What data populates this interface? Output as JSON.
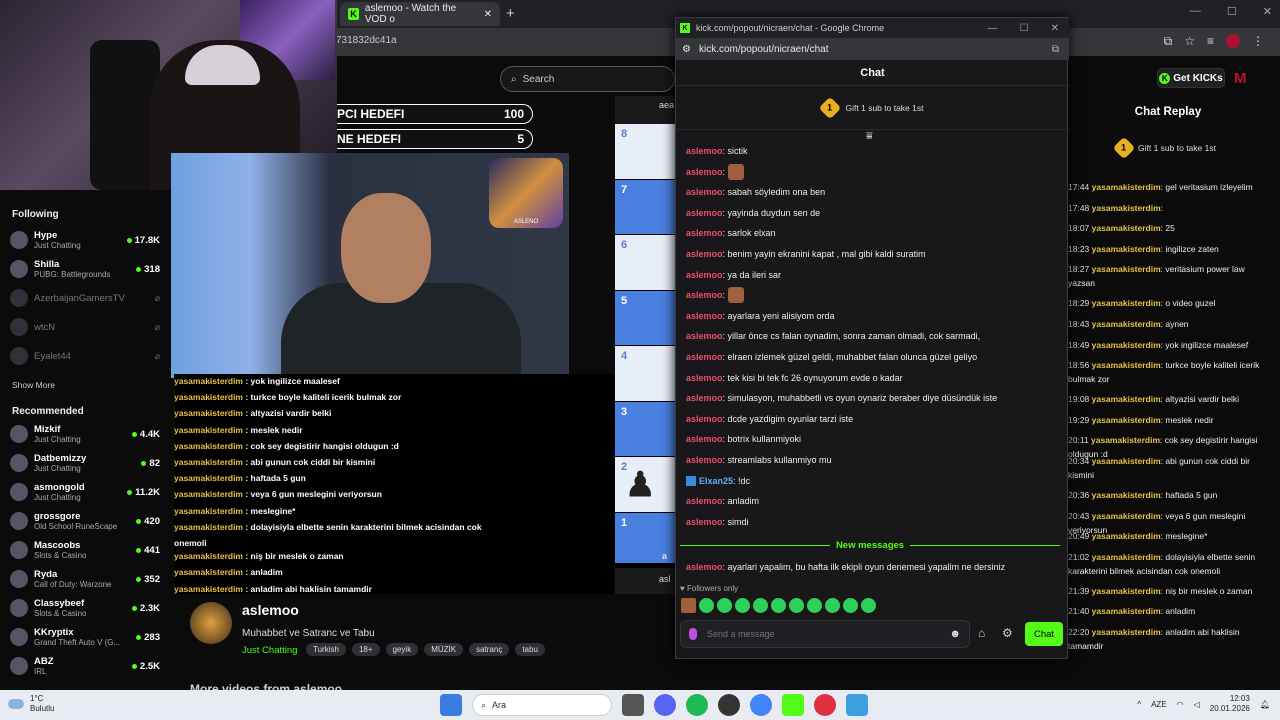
{
  "browser": {
    "tab_title": "aslemoo - Watch the VOD o",
    "url_fragment": "731832dc41a"
  },
  "kick": {
    "search_placeholder": "Search",
    "get_kicks": "Get KICKs",
    "following_heading": "Following",
    "show_more": "Show More",
    "recommended_heading": "Recommended",
    "following": [
      {
        "name": "Hype",
        "category": "Just Chatting",
        "viewers": "17.8K",
        "live": true
      },
      {
        "name": "Shilla",
        "category": "PUBG: Battlegrounds",
        "viewers": "318",
        "live": true
      },
      {
        "name": "AzerbaijanGamersTV",
        "category": "",
        "viewers": "",
        "live": false
      },
      {
        "name": "wtcN",
        "category": "",
        "viewers": "",
        "live": false
      },
      {
        "name": "Eyalet44",
        "category": "",
        "viewers": "",
        "live": false
      }
    ],
    "recommended": [
      {
        "name": "Mizkif",
        "category": "Just Chatting",
        "viewers": "4.4K"
      },
      {
        "name": "Datbemizzy",
        "category": "Just Chatting",
        "viewers": "82"
      },
      {
        "name": "asmongold",
        "category": "Just Chatting",
        "viewers": "11.2K"
      },
      {
        "name": "grossgore",
        "category": "Old School RuneScape",
        "viewers": "420"
      },
      {
        "name": "Mascoobs",
        "category": "Slots & Casino",
        "viewers": "441"
      },
      {
        "name": "Ryda",
        "category": "Call of Duty: Warzone",
        "viewers": "352"
      },
      {
        "name": "Classybeef",
        "category": "Slots & Casino",
        "viewers": "2.3K"
      },
      {
        "name": "KKryptix",
        "category": "Grand Theft Auto V (G...",
        "viewers": "283"
      },
      {
        "name": "ABZ",
        "category": "IRL",
        "viewers": "2.5K"
      }
    ]
  },
  "stream": {
    "goals": [
      {
        "label": "PCI HEDEFI",
        "value": "100"
      },
      {
        "label": "NE HEDEFI",
        "value": "5"
      }
    ],
    "cam_logo_text": "ASLENO",
    "overlay_chat": [
      {
        "user": "yasamakisterdim",
        "text": " : yok ingilizce maalesef"
      },
      {
        "user": "yasamakisterdim",
        "text": " : turkce boyle kaliteli icerik bulmak zor"
      },
      {
        "user": "yasamakisterdim",
        "text": " : altyazisi vardir belki"
      },
      {
        "user": "yasamakisterdim",
        "text": " : meslek nedir"
      },
      {
        "user": "yasamakisterdim",
        "text": " : cok sey degistirir hangisi oldugun :d"
      },
      {
        "user": "yasamakisterdim",
        "text": " : abi gunun cok ciddi bir kismini"
      },
      {
        "user": "yasamakisterdim",
        "text": " : haftada 5 gun"
      },
      {
        "user": "yasamakisterdim",
        "text": " : veya 6 gun meslegini veriyorsun"
      },
      {
        "user": "yasamakisterdim",
        "text": " : meslegine*"
      },
      {
        "user": "yasamakisterdim",
        "text": " : dolayisiyla elbette senin karakterini bilmek acisindan cok"
      },
      {
        "user": "",
        "text": "onemoli"
      },
      {
        "user": "yasamakisterdim",
        "text": " : niş bir meslek o zaman"
      },
      {
        "user": "yasamakisterdim",
        "text": " : anladim"
      },
      {
        "user": "yasamakisterdim",
        "text": " : anladim abi haklisin tamamdir"
      }
    ],
    "board_ranks": [
      "8",
      "7",
      "6",
      "5",
      "4",
      "3",
      "2",
      "1"
    ],
    "board_top_label": "aea",
    "board_bottom_label": "asl",
    "board_file_label": "a",
    "pawn": "♟"
  },
  "stream_info": {
    "channel": "aslemoo",
    "title": "Muhabbet ve Satranc ve Tabu",
    "category": "Just Chatting",
    "tags": [
      "Turkish",
      "18+",
      "geyik",
      "MÜZİK",
      "satranç",
      "tabu"
    ],
    "more_videos": "More videos from aslemoo"
  },
  "replay": {
    "title": "Chat Replay",
    "gift_text": "Gift 1 sub to take 1st",
    "messages": [
      {
        "time": "17:44",
        "user": "yasamakisterdim",
        "text": ": gel veritasium izleyelim"
      },
      {
        "time": "17:48",
        "user": "yasamakisterdim",
        "text": ":"
      },
      {
        "time": "18:07",
        "user": "yasamakisterdim",
        "text": ": 25"
      },
      {
        "time": "18:23",
        "user": "yasamakisterdim",
        "text": ": ingilizce zaten"
      },
      {
        "time": "18:27",
        "user": "yasamakisterdim",
        "text": ": veritasium power law yazsan"
      },
      {
        "time": "18:29",
        "user": "yasamakisterdim",
        "text": ": o video guzel"
      },
      {
        "time": "18:43",
        "user": "yasamakisterdim",
        "text": ": aynen"
      },
      {
        "time": "18:49",
        "user": "yasamakisterdim",
        "text": ": yok ingilizce maalesef"
      },
      {
        "time": "18:56",
        "user": "yasamakisterdim",
        "text": ": turkce boyle kaliteli icerik bulmak zor"
      },
      {
        "time": "19:08",
        "user": "yasamakisterdim",
        "text": ": altyazisi vardir belki"
      },
      {
        "time": "19:29",
        "user": "yasamakisterdim",
        "text": ": meslek nedir"
      },
      {
        "time": "20:11",
        "user": "yasamakisterdim",
        "text": ": cok sey degistirir hangisi oldugun :d"
      },
      {
        "time": "20:34",
        "user": "yasamakisterdim",
        "text": ": abi gunun cok ciddi bir kismini"
      },
      {
        "time": "20:36",
        "user": "yasamakisterdim",
        "text": ": haftada 5 gun"
      },
      {
        "time": "20:43",
        "user": "yasamakisterdim",
        "text": ": veya 6 gun meslegini veriyorsun"
      },
      {
        "time": "20:49",
        "user": "yasamakisterdim",
        "text": ": meslegine*"
      },
      {
        "time": "21:02",
        "user": "yasamakisterdim",
        "text": ": dolayisiyla elbette senin karakterini bilmek acisindan cok onemoli"
      },
      {
        "time": "21:39",
        "user": "yasamakisterdim",
        "text": ": niş bir meslek o zaman"
      },
      {
        "time": "21:40",
        "user": "yasamakisterdim",
        "text": ": anladim"
      },
      {
        "time": "22:20",
        "user": "yasamakisterdim",
        "text": ": anladim abi haklisin tamamdir"
      }
    ]
  },
  "popout": {
    "window_title": "kick.com/popout/nicraen/chat - Google Chrome",
    "url": "kick.com/popout/nicraen/chat",
    "header": "Chat",
    "gift_text": "Gift 1 sub to take 1st",
    "messages": [
      {
        "user": "aslemoo",
        "text": ": sictik"
      },
      {
        "user": "aslemoo",
        "text": ":",
        "emote": true
      },
      {
        "user": "aslemoo",
        "text": ": sabah söyledim ona ben"
      },
      {
        "user": "aslemoo",
        "text": ": yayinda duydun sen de"
      },
      {
        "user": "aslemoo",
        "text": ": sarlok elxan"
      },
      {
        "user": "aslemoo",
        "text": ": benim yayin ekranini kapat , mal gibi kaldi suratim"
      },
      {
        "user": "aslemoo",
        "text": ": ya da ileri sar"
      },
      {
        "user": "aslemoo",
        "text": ":",
        "emote": true
      },
      {
        "user": "aslemoo",
        "text": ": ayarlara yeni alisiyom orda"
      },
      {
        "user": "aslemoo",
        "text": ": yillar önce cs falan oynadim, sonra zaman olmadi, cok sarmadi,"
      },
      {
        "user": "aslemoo",
        "text": ": elraen izlemek güzel geldi, muhabbet falan olunca güzel geliyo"
      },
      {
        "user": "aslemoo",
        "text": ": tek kisi bi tek fc 26 oynuyorum evde o kadar"
      },
      {
        "user": "aslemoo",
        "text": ": simulasyon, muhabbetli vs oyun oynariz beraber diye düsündük iste"
      },
      {
        "user": "aslemoo",
        "text": ": dcde yazdigim oyunlar tarzi iste"
      },
      {
        "user": "aslemoo",
        "text": ": botrix kullanmiyoki"
      },
      {
        "user": "aslemoo",
        "text": ": streamlabs kullanmiyo mu"
      },
      {
        "user": "Elxan25",
        "text": ": !dc",
        "blue": true
      },
      {
        "user": "aslemoo",
        "text": ": anladim"
      },
      {
        "user": "aslemoo",
        "text": ": simdi"
      }
    ],
    "new_messages": "New messages",
    "after_new": {
      "user": "aslemoo",
      "text": ": ayarlari yapalim, bu hafta ilk ekipli oyun denemesi yapalim ne dersiniz"
    },
    "followers_only": "Followers only",
    "input_placeholder": "Send a message",
    "chat_button": "Chat"
  },
  "taskbar": {
    "temp": "1°C",
    "weather": "Bulutlu",
    "search": "Ara",
    "lang": "AZE",
    "time": "12:03",
    "date": "20.01.2026"
  },
  "colors": {
    "kick_green": "#53fc18",
    "chat_user_red": "#e8506a",
    "replay_user_gold": "#e6c34a"
  }
}
